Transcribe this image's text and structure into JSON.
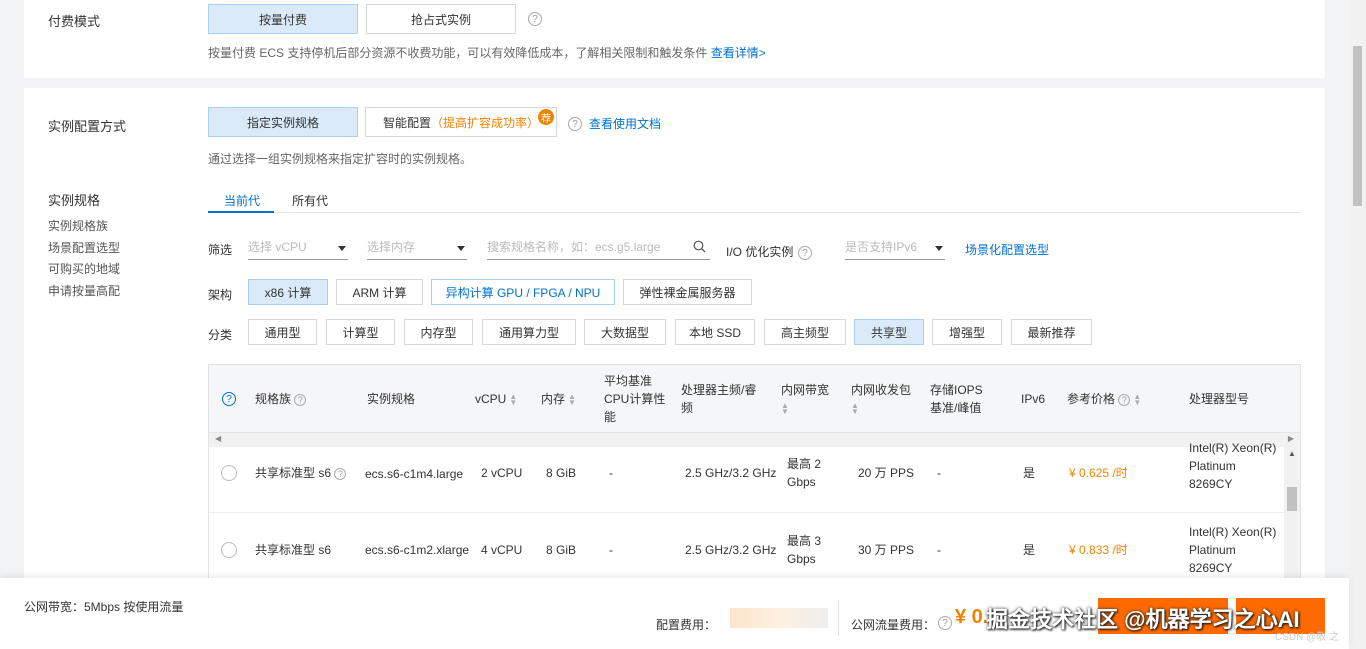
{
  "billing": {
    "label": "付费模式",
    "options": [
      "按量付费",
      "抢占式实例"
    ],
    "hint": "按量付费 ECS 支持停机后部分资源不收费功能，可以有效降低成本，了解相关限制和触发条件",
    "hint_link": "查看详情>"
  },
  "config_method": {
    "label": "实例配置方式",
    "options": [
      "指定实例规格",
      "智能配置"
    ],
    "smart_note": "（提高扩容成功率）",
    "badge": "荐",
    "doc_link": "查看使用文档",
    "hint": "通过选择一组实例规格来指定扩容时的实例规格。"
  },
  "spec_nav": {
    "title": "实例规格",
    "items": [
      "实例规格族",
      "场景配置选型",
      "可购买的地域",
      "申请按量高配"
    ]
  },
  "tabs": [
    "当前代",
    "所有代"
  ],
  "filters": {
    "label": "筛选",
    "vcpu_placeholder": "选择 vCPU",
    "mem_placeholder": "选择内存",
    "search_placeholder": "搜索规格名称，如：ecs.g5.large",
    "io_label": "I/O 优化实例",
    "ipv6_placeholder": "是否支持IPv6",
    "scene_link": "场景化配置选型"
  },
  "arch": {
    "label": "架构",
    "options": [
      "x86 计算",
      "ARM 计算",
      "异构计算 GPU / FPGA / NPU",
      "弹性裸金属服务器"
    ]
  },
  "category": {
    "label": "分类",
    "options": [
      "通用型",
      "计算型",
      "内存型",
      "通用算力型",
      "大数据型",
      "本地 SSD",
      "高主频型",
      "共享型",
      "增强型",
      "最新推荐"
    ]
  },
  "table": {
    "headers": {
      "family": "规格族",
      "spec": "实例规格",
      "vcpu": "vCPU",
      "mem": "内存",
      "baseline": "平均基准\nCPU计算性\n能",
      "freq": "处理器主频/睿\n频",
      "bw": "内网带宽",
      "pps": "内网收发包",
      "iops": "存储IOPS\n基准/峰值",
      "ipv6": "IPv6",
      "price": "参考价格",
      "cpu": "处理器型号"
    },
    "rows": [
      {
        "family": "共享标准型 s6",
        "spec": "ecs.s6-c1m4.large",
        "vcpu": "2 vCPU",
        "mem": "8 GiB",
        "baseline": "-",
        "freq": "2.5 GHz/3.2 GHz",
        "bw": "最高 2\nGbps",
        "pps": "20 万 PPS",
        "iops": "-",
        "ipv6": "是",
        "price": "¥ 0.625 /时",
        "cpu": "Intel(R) Xeon(R)\nPlatinum\n8269CY"
      },
      {
        "family": "共享标准型 s6",
        "spec": "ecs.s6-c1m2.xlarge",
        "vcpu": "4 vCPU",
        "mem": "8 GiB",
        "baseline": "-",
        "freq": "2.5 GHz/3.2 GHz",
        "bw": "最高 3\nGbps",
        "pps": "30 万 PPS",
        "iops": "-",
        "ipv6": "是",
        "price": "¥ 0.833 /时",
        "cpu": "Intel(R) Xeon(R)\nPlatinum\n8269CY"
      }
    ]
  },
  "footer": {
    "bandwidth": "公网带宽：5Mbps 按使用流量",
    "config_fee_label": "配置费用：",
    "traffic_fee_label": "公网流量费用：",
    "traffic_fee_value": "¥ 0.",
    "watermark": "掘金技术社区 @机器学习之心AI",
    "csdn": "CSDN @敬 之"
  }
}
